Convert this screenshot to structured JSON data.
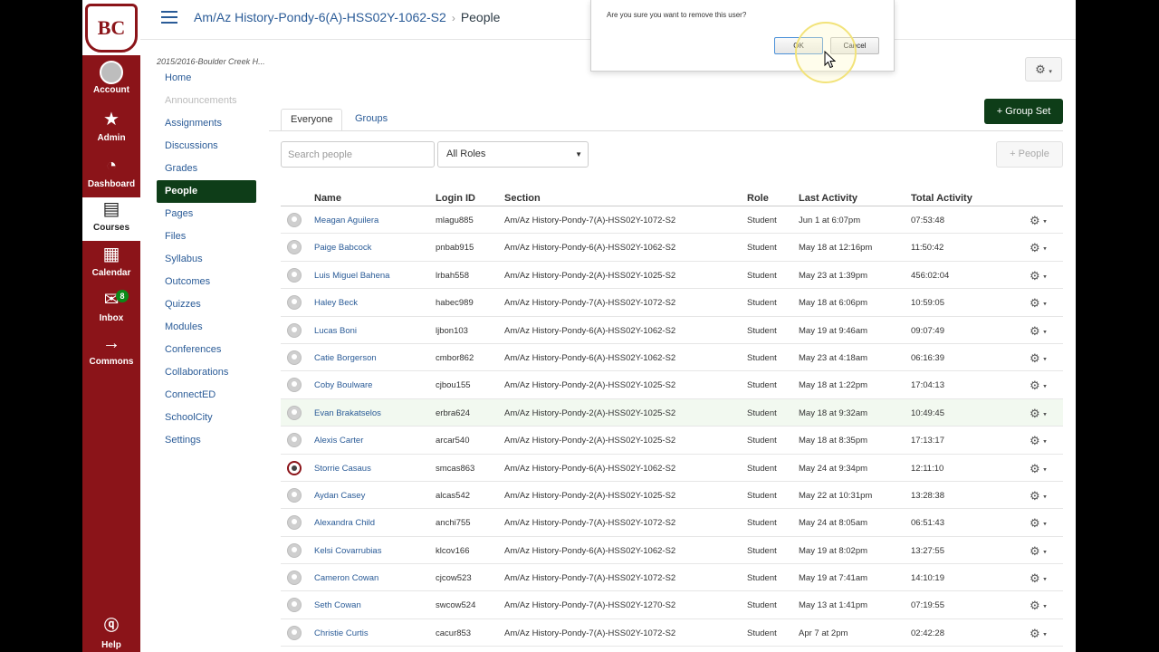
{
  "global_nav": {
    "logo_text": "BC",
    "items": [
      {
        "label": "Account"
      },
      {
        "label": "Admin"
      },
      {
        "label": "Dashboard"
      },
      {
        "label": "Courses"
      },
      {
        "label": "Calendar"
      },
      {
        "label": "Inbox",
        "badge": "8"
      },
      {
        "label": "Commons"
      }
    ],
    "help_label": "Help"
  },
  "header": {
    "course": "Am/Az History-Pondy-6(A)-HSS02Y-1062-S2",
    "separator": "›",
    "page": "People"
  },
  "course_nav": {
    "term": "2015/2016-Boulder Creek H...",
    "items": [
      {
        "label": "Home",
        "state": "normal"
      },
      {
        "label": "Announcements",
        "state": "disabled"
      },
      {
        "label": "Assignments",
        "state": "normal"
      },
      {
        "label": "Discussions",
        "state": "normal"
      },
      {
        "label": "Grades",
        "state": "normal"
      },
      {
        "label": "People",
        "state": "active"
      },
      {
        "label": "Pages",
        "state": "normal"
      },
      {
        "label": "Files",
        "state": "normal"
      },
      {
        "label": "Syllabus",
        "state": "normal"
      },
      {
        "label": "Outcomes",
        "state": "normal"
      },
      {
        "label": "Quizzes",
        "state": "normal"
      },
      {
        "label": "Modules",
        "state": "normal"
      },
      {
        "label": "Conferences",
        "state": "normal"
      },
      {
        "label": "Collaborations",
        "state": "normal"
      },
      {
        "label": "ConnectED",
        "state": "normal"
      },
      {
        "label": "SchoolCity",
        "state": "normal"
      },
      {
        "label": "Settings",
        "state": "normal"
      }
    ]
  },
  "tabs": {
    "everyone": "Everyone",
    "groups": "Groups"
  },
  "toolbar": {
    "group_set_label": "+ Group Set",
    "search_placeholder": "Search people",
    "roles_selected": "All Roles",
    "add_people_label": "+ People"
  },
  "table": {
    "headers": {
      "name": "Name",
      "login": "Login ID",
      "section": "Section",
      "role": "Role",
      "last": "Last Activity",
      "total": "Total Activity"
    },
    "rows": [
      {
        "name": "Meagan Aguilera",
        "login": "mlagu885",
        "section": "Am/Az History-Pondy-7(A)-HSS02Y-1072-S2",
        "role": "Student",
        "last": "Jun 1 at 6:07pm",
        "total": "07:53:48"
      },
      {
        "name": "Paige Babcock",
        "login": "pnbab915",
        "section": "Am/Az History-Pondy-6(A)-HSS02Y-1062-S2",
        "role": "Student",
        "last": "May 18 at 12:16pm",
        "total": "11:50:42"
      },
      {
        "name": "Luis Miguel Bahena",
        "login": "lrbah558",
        "section": "Am/Az History-Pondy-2(A)-HSS02Y-1025-S2",
        "role": "Student",
        "last": "May 23 at 1:39pm",
        "total": "456:02:04"
      },
      {
        "name": "Haley Beck",
        "login": "habec989",
        "section": "Am/Az History-Pondy-7(A)-HSS02Y-1072-S2",
        "role": "Student",
        "last": "May 18 at 6:06pm",
        "total": "10:59:05"
      },
      {
        "name": "Lucas Boni",
        "login": "ljbon103",
        "section": "Am/Az History-Pondy-6(A)-HSS02Y-1062-S2",
        "role": "Student",
        "last": "May 19 at 9:46am",
        "total": "09:07:49"
      },
      {
        "name": "Catie Borgerson",
        "login": "cmbor862",
        "section": "Am/Az History-Pondy-6(A)-HSS02Y-1062-S2",
        "role": "Student",
        "last": "May 23 at 4:18am",
        "total": "06:16:39"
      },
      {
        "name": "Coby Boulware",
        "login": "cjbou155",
        "section": "Am/Az History-Pondy-2(A)-HSS02Y-1025-S2",
        "role": "Student",
        "last": "May 18 at 1:22pm",
        "total": "17:04:13"
      },
      {
        "name": "Evan Brakatselos",
        "login": "erbra624",
        "section": "Am/Az History-Pondy-2(A)-HSS02Y-1025-S2",
        "role": "Student",
        "last": "May 18 at 9:32am",
        "total": "10:49:45"
      },
      {
        "name": "Alexis Carter",
        "login": "arcar540",
        "section": "Am/Az History-Pondy-2(A)-HSS02Y-1025-S2",
        "role": "Student",
        "last": "May 18 at 8:35pm",
        "total": "17:13:17"
      },
      {
        "name": "Storrie Casaus",
        "login": "smcas863",
        "section": "Am/Az History-Pondy-6(A)-HSS02Y-1062-S2",
        "role": "Student",
        "last": "May 24 at 9:34pm",
        "total": "12:11:10"
      },
      {
        "name": "Aydan Casey",
        "login": "alcas542",
        "section": "Am/Az History-Pondy-2(A)-HSS02Y-1025-S2",
        "role": "Student",
        "last": "May 22 at 10:31pm",
        "total": "13:28:38"
      },
      {
        "name": "Alexandra Child",
        "login": "anchi755",
        "section": "Am/Az History-Pondy-7(A)-HSS02Y-1072-S2",
        "role": "Student",
        "last": "May 24 at 8:05am",
        "total": "06:51:43"
      },
      {
        "name": "Kelsi Covarrubias",
        "login": "klcov166",
        "section": "Am/Az History-Pondy-6(A)-HSS02Y-1062-S2",
        "role": "Student",
        "last": "May 19 at 8:02pm",
        "total": "13:27:55"
      },
      {
        "name": "Cameron Cowan",
        "login": "cjcow523",
        "section": "Am/Az History-Pondy-7(A)-HSS02Y-1072-S2",
        "role": "Student",
        "last": "May 19 at 7:41am",
        "total": "14:10:19"
      },
      {
        "name": "Seth Cowan",
        "login": "swcow524",
        "section": "Am/Az History-Pondy-7(A)-HSS02Y-1270-S2",
        "role": "Student",
        "last": "May 13 at 1:41pm",
        "total": "07:19:55"
      },
      {
        "name": "Christie Curtis",
        "login": "cacur853",
        "section": "Am/Az History-Pondy-7(A)-HSS02Y-1072-S2",
        "role": "Student",
        "last": "Apr 7 at 2pm",
        "total": "02:42:28"
      }
    ]
  },
  "dialog": {
    "message": "Are you sure you want to remove this user?",
    "ok_label": "OK",
    "cancel_label": "Cancel"
  }
}
